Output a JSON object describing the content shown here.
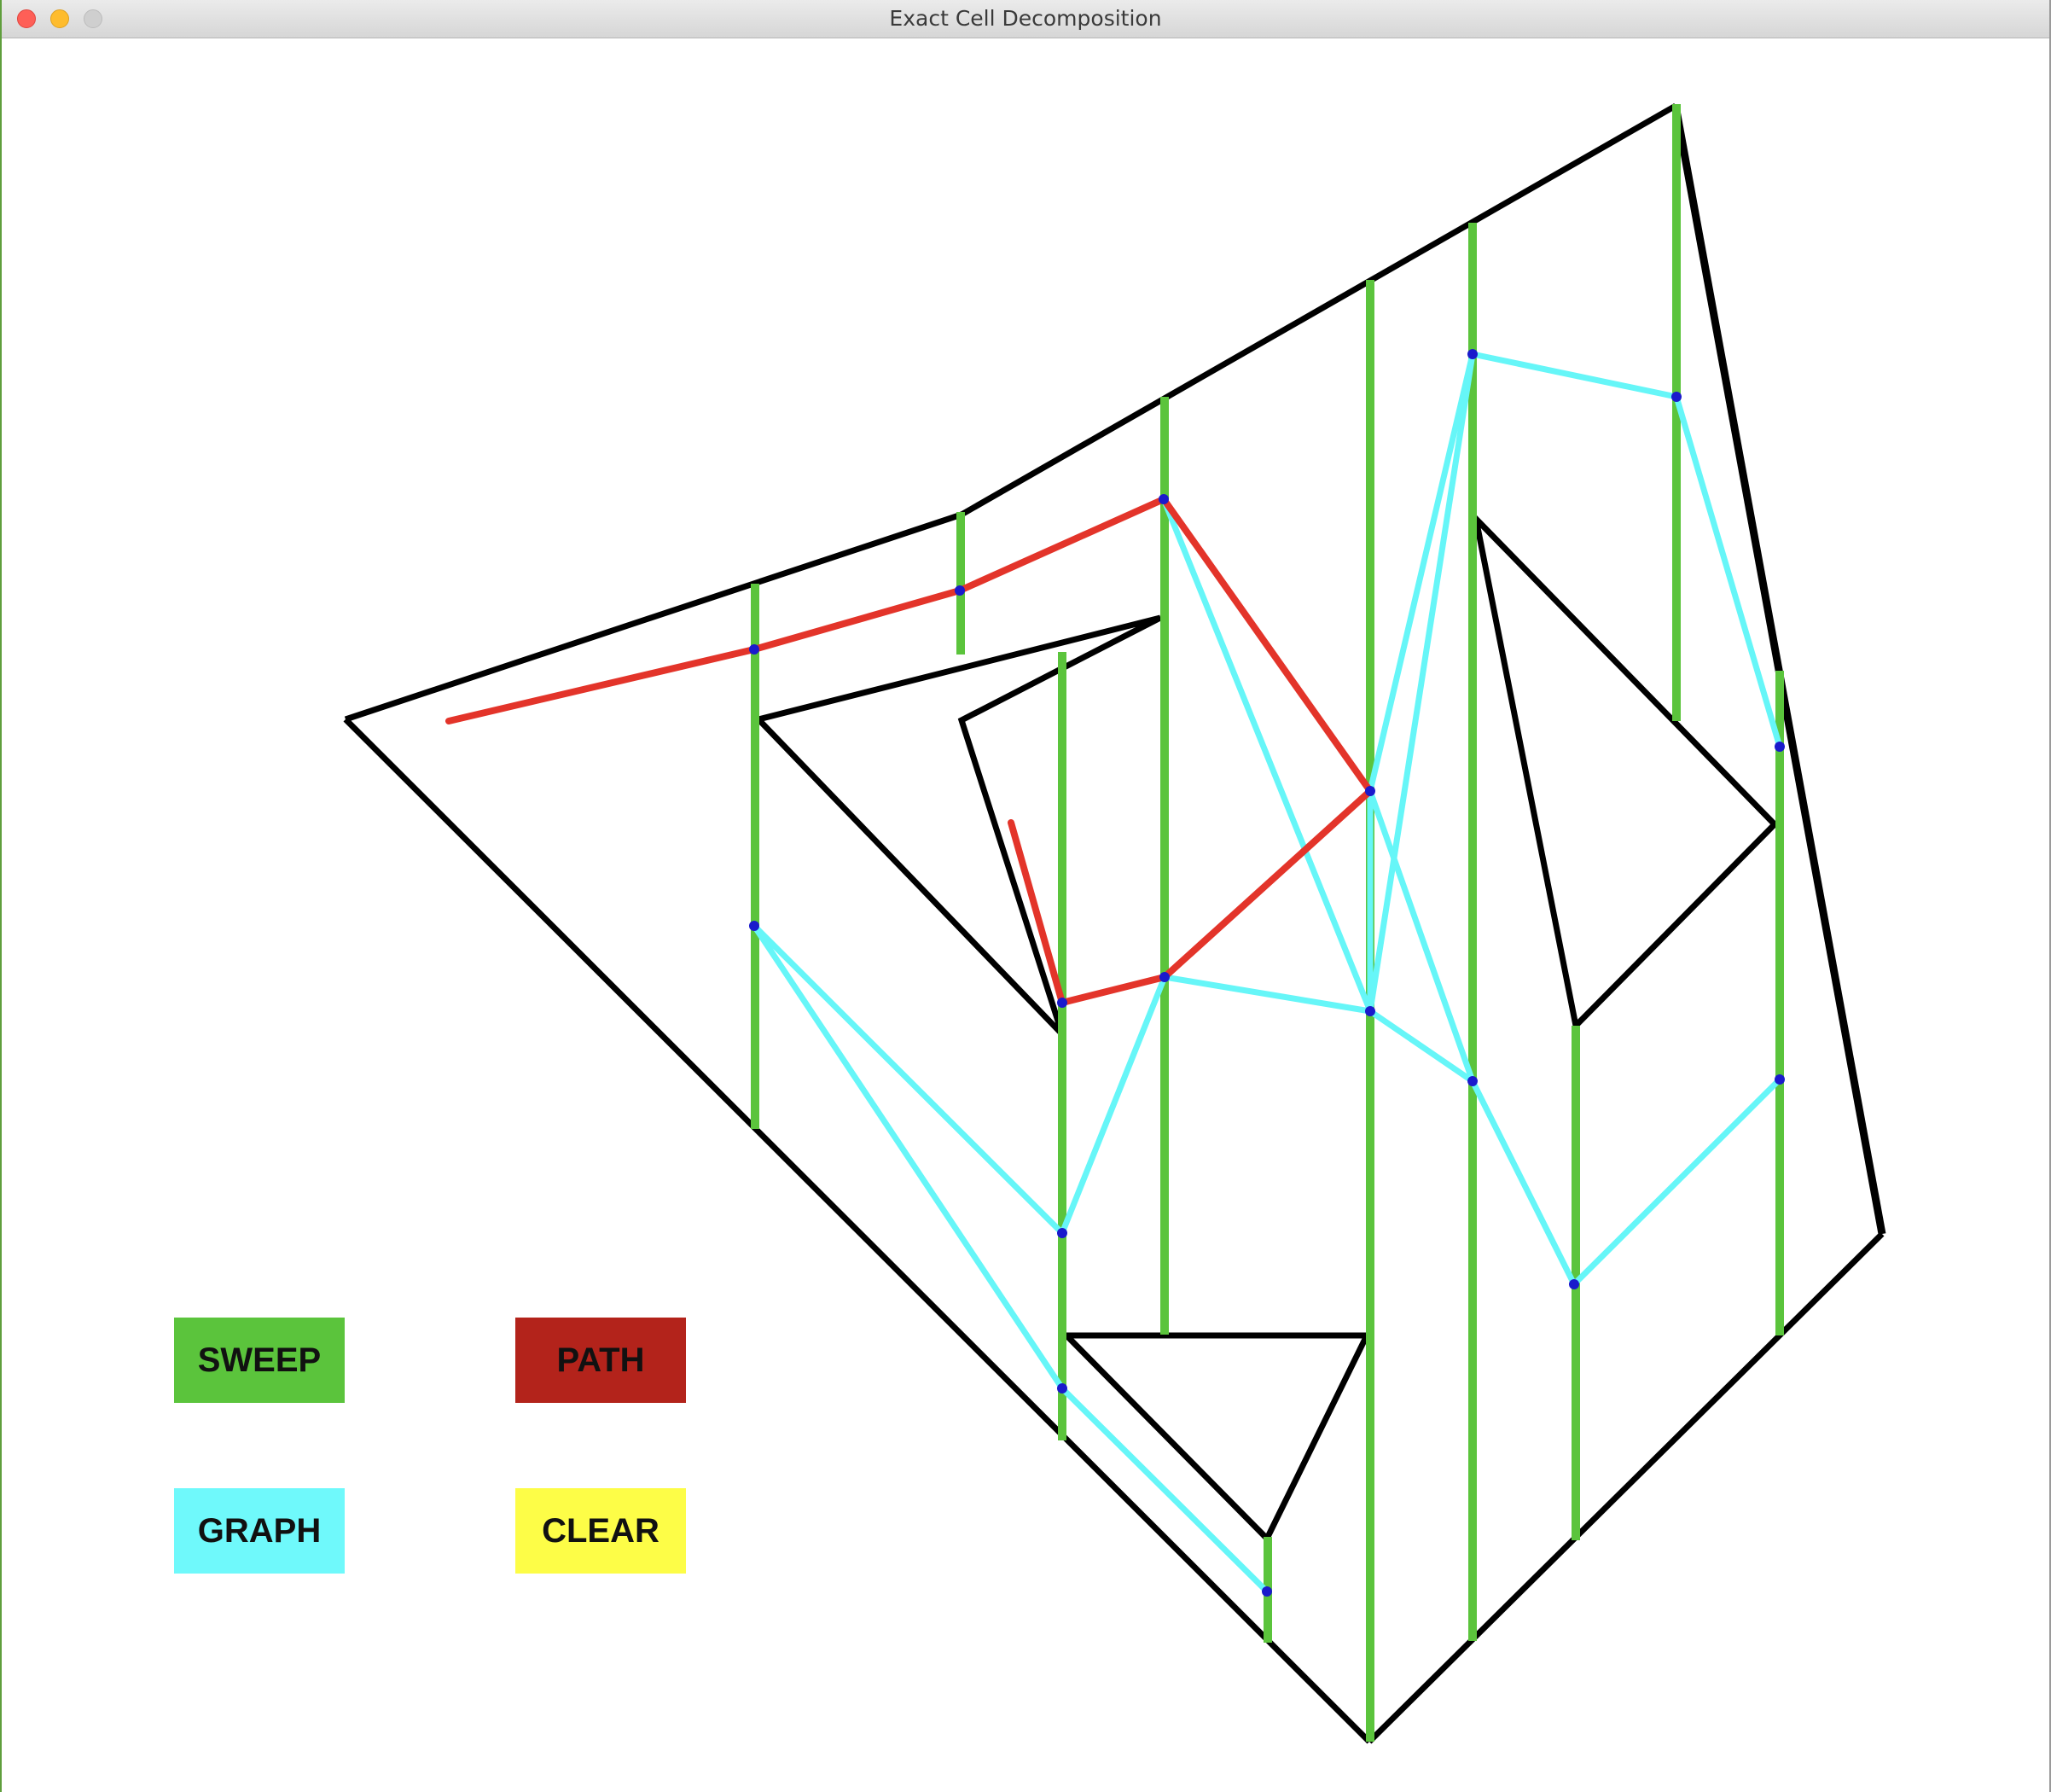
{
  "window": {
    "title": "Exact Cell Decomposition"
  },
  "colors": {
    "obstacle": "#000000",
    "sweep_lines": "#5bc43c",
    "graph_edges": "#66f6f8",
    "path": "#e3342a",
    "nodes": "#1a1acc",
    "sweep_button": "#5bc43c",
    "path_button": "#b3231b",
    "graph_button": "#6ff9fb",
    "clear_button": "#fdfd47"
  },
  "buttons": {
    "sweep": "SWEEP",
    "path": "PATH",
    "graph": "GRAPH",
    "clear": "CLEAR"
  }
}
